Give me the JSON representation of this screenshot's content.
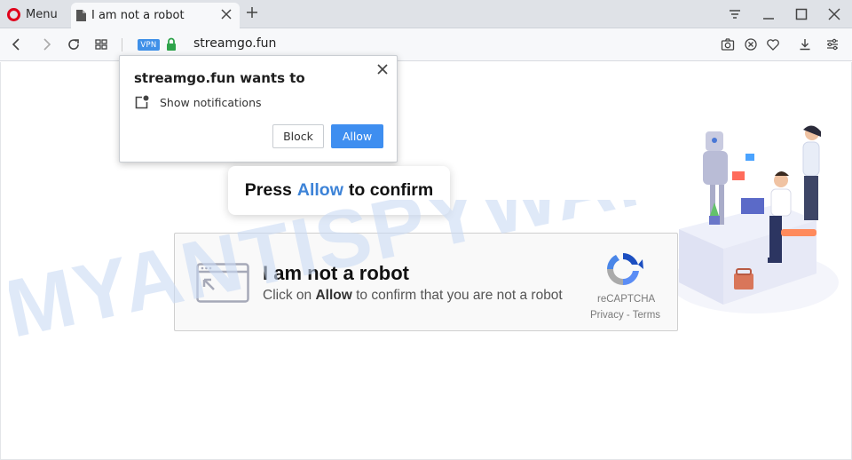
{
  "browser": {
    "menu_label": "Menu",
    "tab_title": "I am not a robot",
    "vpn_badge": "VPN",
    "url": "streamgo.fun"
  },
  "notification_popup": {
    "title": "streamgo.fun wants to",
    "permission": "Show notifications",
    "block_label": "Block",
    "allow_label": "Allow"
  },
  "press_banner": {
    "before": "Press",
    "highlight": "Allow",
    "after": "to confirm"
  },
  "captcha": {
    "title": "I am not a robot",
    "sub_before": "Click on",
    "sub_bold": "Allow",
    "sub_after": "to confirm that you are not a robot",
    "brand": "reCAPTCHA",
    "links": "Privacy - Terms"
  },
  "watermark": "MYANTISPYWARE.COM",
  "colors": {
    "accent_blue": "#3e8ef0",
    "opera_red": "#e0001b",
    "highlight_blue": "#3d83d7"
  }
}
